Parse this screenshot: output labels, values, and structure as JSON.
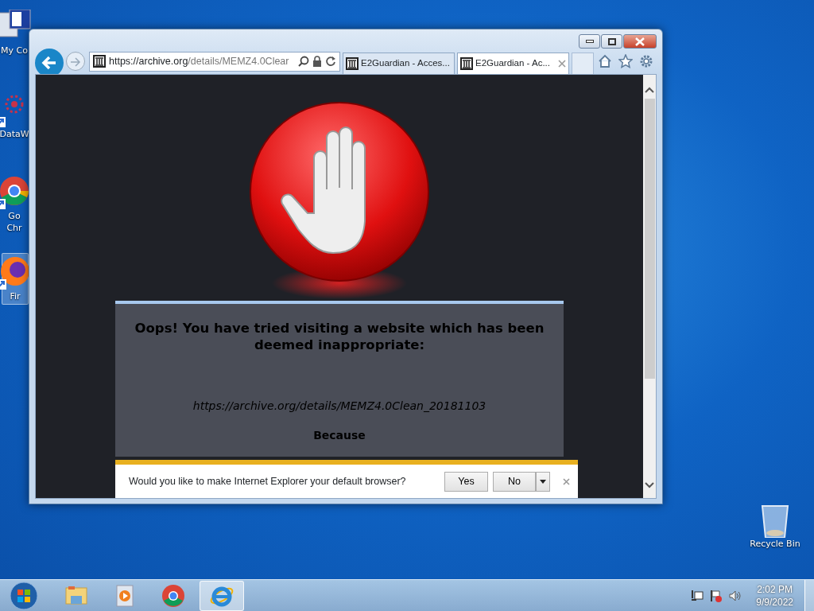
{
  "desktop_icons": [
    {
      "kind": "computer",
      "lines": [
        "My Co"
      ],
      "selected": false
    },
    {
      "kind": "flower",
      "lines": [
        "DataW"
      ],
      "selected": false
    },
    {
      "kind": "chrome",
      "lines": [
        "Go",
        "Chr"
      ],
      "selected": false
    },
    {
      "kind": "firefox",
      "lines": [
        "Fir"
      ],
      "selected": true
    },
    {
      "kind": "bin",
      "lines": [
        "Recycle Bin"
      ],
      "selected": false
    }
  ],
  "browser": {
    "address": {
      "domain": "https://archive.org",
      "path": "/details/MEMZ4.0Clear"
    },
    "tabs": [
      {
        "title": "E2Guardian - Acces...",
        "selected": false
      },
      {
        "title": "E2Guardian - Ac...",
        "selected": true
      }
    ]
  },
  "page": {
    "heading": "Oops! You have tried visiting a website which has been deemed inappropriate:",
    "url": "https://archive.org/details/MEMZ4.0Clean_20181103",
    "reason_label": "Because"
  },
  "notification": {
    "message": "Would you like to make Internet Explorer your default browser?",
    "buttons": [
      "Yes",
      "No"
    ]
  },
  "taskbar": {
    "apps": [
      {
        "kind": "explorer",
        "selected": false
      },
      {
        "kind": "media",
        "selected": false
      },
      {
        "kind": "chrome",
        "selected": false
      },
      {
        "kind": "ie",
        "selected": true
      }
    ],
    "time": "2:02 PM",
    "date": "9/9/2022"
  }
}
